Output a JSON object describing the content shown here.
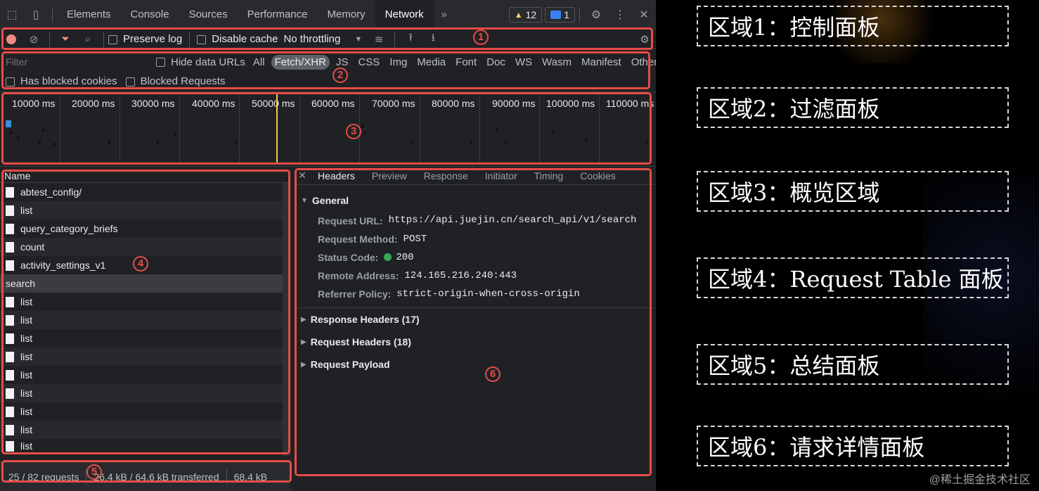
{
  "devtools": {
    "tabs": [
      "Elements",
      "Console",
      "Sources",
      "Performance",
      "Memory",
      "Network"
    ],
    "active_tab": "Network",
    "warnings_count": "12",
    "messages_count": "1"
  },
  "toolbar": {
    "preserve_log": "Preserve log",
    "disable_cache": "Disable cache",
    "throttling": "No throttling"
  },
  "filter": {
    "placeholder": "Filter",
    "hide_data_urls": "Hide data URLs",
    "types": [
      "All",
      "Fetch/XHR",
      "JS",
      "CSS",
      "Img",
      "Media",
      "Font",
      "Doc",
      "WS",
      "Wasm",
      "Manifest",
      "Other"
    ],
    "active_type": "Fetch/XHR",
    "has_blocked_cookies": "Has blocked cookies",
    "blocked_requests": "Blocked Requests"
  },
  "overview": {
    "ticks": [
      "10000 ms",
      "20000 ms",
      "30000 ms",
      "40000 ms",
      "50000 ms",
      "60000 ms",
      "70000 ms",
      "80000 ms",
      "90000 ms",
      "100000 ms",
      "110000 ms"
    ]
  },
  "request_table": {
    "header": "Name",
    "rows": [
      "abtest_config/",
      "list",
      "query_category_briefs",
      "count",
      "activity_settings_v1",
      "search",
      "list",
      "list",
      "list",
      "list",
      "list",
      "list",
      "list",
      "list",
      "list"
    ],
    "selected": "search"
  },
  "summary": {
    "requests": "25 / 82 requests",
    "transferred": "26.4 kB / 64.6 kB transferred",
    "resources": "68.4 kB"
  },
  "details": {
    "tabs": [
      "Headers",
      "Preview",
      "Response",
      "Initiator",
      "Timing",
      "Cookies"
    ],
    "active_tab": "Headers",
    "general": {
      "title": "General",
      "request_url_label": "Request URL:",
      "request_url": "https://api.juejin.cn/search_api/v1/search",
      "request_method_label": "Request Method:",
      "request_method": "POST",
      "status_code_label": "Status Code:",
      "status_code": "200",
      "remote_address_label": "Remote Address:",
      "remote_address": "124.165.216.240:443",
      "referrer_policy_label": "Referrer Policy:",
      "referrer_policy": "strict-origin-when-cross-origin"
    },
    "sections": [
      "Response Headers (17)",
      "Request Headers (18)",
      "Request Payload"
    ]
  },
  "region_numbers": [
    "1",
    "2",
    "3",
    "4",
    "5",
    "6"
  ],
  "legend": [
    "区域1：控制面板",
    "区域2：过滤面板",
    "区域3：概览区域",
    "区域4：Request Table 面板",
    "区域5：总结面板",
    "区域6：请求详情面板"
  ],
  "watermark": "@稀土掘金技术社区",
  "colors": {
    "highlight": "#e74c47",
    "status_ok": "#34a853",
    "active_tab_underline": "#8ab4f8"
  }
}
